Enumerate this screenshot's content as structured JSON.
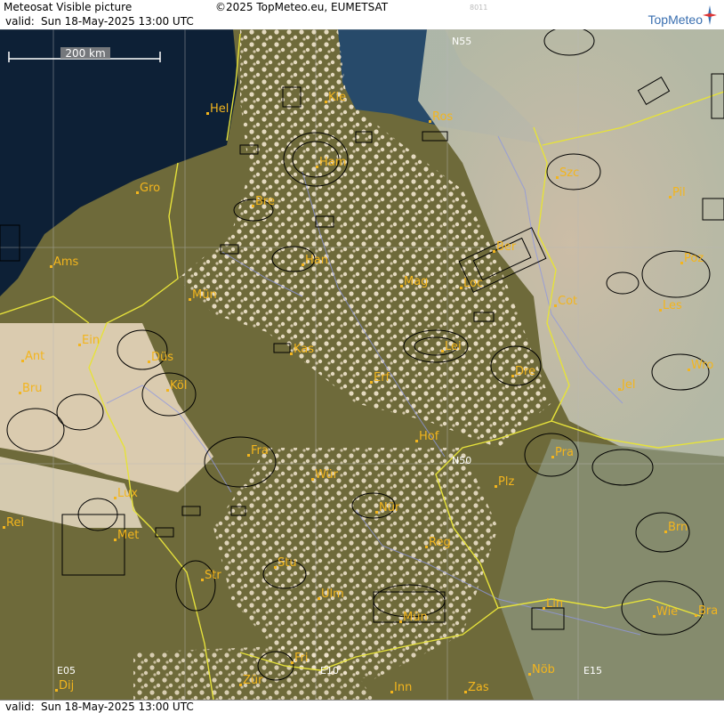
{
  "header": {
    "title": "Meteosat Visible picture",
    "copyright": "©2025 TopMeteo.eu, EUMETSAT",
    "code": "8011",
    "valid_label": "valid:",
    "valid_time": "Sun  18-May-2025  13:00 UTC",
    "logo": "TopMeteo"
  },
  "footer": {
    "valid_label": "valid:",
    "valid_time": "Sun  18-May-2025  13:00 UTC"
  },
  "scale_bar": {
    "label": "200 km"
  },
  "grid_labels": [
    "N55",
    "N50",
    "E05",
    "E10",
    "E15"
  ],
  "cities": [
    "Hel",
    "Kie",
    "Ros",
    "Ham",
    "Szc",
    "Gro",
    "Bre",
    "Pil",
    "Ams",
    "Han",
    "Ber",
    "Poz",
    "Mün",
    "Mag",
    "Loc",
    "Cot",
    "Les",
    "Ein",
    "Kas",
    "Lei",
    "Ant",
    "Düs",
    "Dre",
    "Wro",
    "Bru",
    "Köl",
    "Erf",
    "Jel",
    "Hof",
    "Fra",
    "Pra",
    "Wür",
    "Plz",
    "Lux",
    "Nür",
    "Rei",
    "Met",
    "Reg",
    "Brn",
    "Stu",
    "Str",
    "Ulm",
    "Lin",
    "Mün",
    "Wie",
    "Bra",
    "Fri",
    "Dij",
    "Zür",
    "Inn",
    "Zas",
    "Nöb"
  ],
  "colors": {
    "sea": "#0d2036",
    "land": "#6e6a3a",
    "cloud": "#e9d9bf",
    "border": "#e6e23a",
    "city": "#f3b51d",
    "rivers": "#8f97e0"
  }
}
